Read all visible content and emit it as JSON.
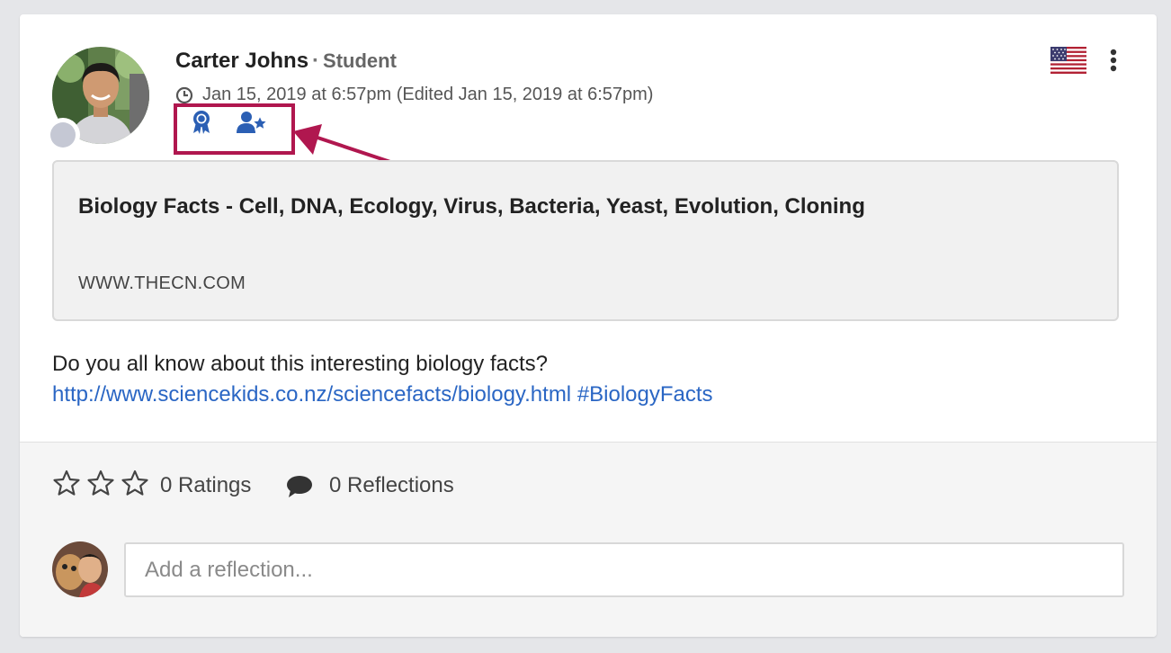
{
  "post": {
    "author_name": "Carter Johns",
    "separator": "·",
    "author_role": "Student",
    "timestamp": "Jan 15, 2019 at 6:57pm",
    "edited": "(Edited Jan 15, 2019 at 6:57pm)",
    "country_flag": "us-flag-icon",
    "badges": [
      "award-ribbon-icon",
      "user-star-icon"
    ],
    "annotation_color": "#b0174f"
  },
  "link_preview": {
    "title": "Biology Facts - Cell, DNA, Ecology, Virus, Bacteria, Yeast, Evolution, Cloning",
    "domain": "WWW.THECN.COM"
  },
  "body": {
    "text": "Do you all know about this interesting biology facts?",
    "url": "http://www.sciencekids.co.nz/sciencefacts/biology.html",
    "hashtag": "#BiologyFacts"
  },
  "footer": {
    "rating_stars_filled": 0,
    "rating_stars_total": 3,
    "ratings_label": "0 Ratings",
    "reflections_label": "0 Reflections",
    "input_placeholder": "Add a reflection..."
  },
  "colors": {
    "link": "#2a66c4",
    "badge": "#2b5fb4",
    "presence": "#c5c8d4"
  }
}
